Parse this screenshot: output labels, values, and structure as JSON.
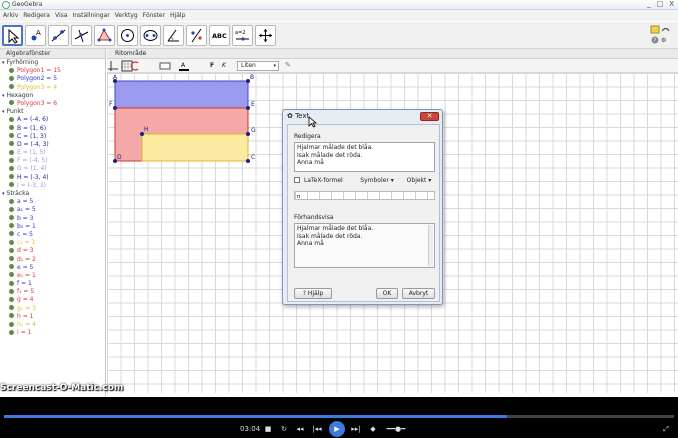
{
  "window": {
    "title": "GeoGebra",
    "controls": [
      "_",
      "□",
      "X"
    ]
  },
  "menu": [
    "Arkiv",
    "Redigera",
    "Visa",
    "Inställningar",
    "Verktyg",
    "Fönster",
    "Hjälp"
  ],
  "toolbar": {
    "tools": [
      "move-tool",
      "point-tool",
      "line-tool",
      "perpendicular-line-tool",
      "polygon-tool",
      "circle-tool",
      "ellipse-tool",
      "angle-tool",
      "reflect-tool",
      "text-tool",
      "slider-tool",
      "move-graphics-view-tool"
    ],
    "text_tool_label": "ABC",
    "slider_label": "a=2"
  },
  "algebra": {
    "title": "Algebrafönster",
    "groups": [
      {
        "name": "Fyrhörning",
        "items": [
          {
            "text": "Polygon1 = 15",
            "color": "#d8333a"
          },
          {
            "text": "Polygon2 = 5",
            "color": "#3333cc"
          },
          {
            "text": "Polygon3 = 4",
            "color": "#e0c030"
          }
        ]
      },
      {
        "name": "Hexagon",
        "items": [
          {
            "text": "Polygon3 = 6",
            "color": "#d8333a"
          }
        ]
      },
      {
        "name": "Punkt",
        "items": [
          {
            "text": "A = (-4, 6)",
            "color": "#2222aa"
          },
          {
            "text": "B = (1, 6)",
            "color": "#2222aa"
          },
          {
            "text": "C = (1, 3)",
            "color": "#2222aa"
          },
          {
            "text": "D = (-4, 3)",
            "color": "#2222aa"
          },
          {
            "text": "E = (1, 5)",
            "color": "#9999dd"
          },
          {
            "text": "F = (-4, 5)",
            "color": "#9999dd"
          },
          {
            "text": "G = (1, 4)",
            "color": "#9999dd"
          },
          {
            "text": "H = (-3, 4)",
            "color": "#2222aa"
          },
          {
            "text": "I = (-3, 3)",
            "color": "#9999dd"
          }
        ]
      },
      {
        "name": "Sträcka",
        "items": [
          {
            "text": "a = 5",
            "color": "#3333cc"
          },
          {
            "text": "a₁ = 5",
            "color": "#3333cc"
          },
          {
            "text": "b = 3",
            "color": "#3333cc"
          },
          {
            "text": "b₁ = 1",
            "color": "#3333cc"
          },
          {
            "text": "c = 5",
            "color": "#3333cc"
          },
          {
            "text": "c₁ = 1",
            "color": "#e0c030"
          },
          {
            "text": "d = 3",
            "color": "#d8333a"
          },
          {
            "text": "d₁ = 2",
            "color": "#d8333a"
          },
          {
            "text": "e = 5",
            "color": "#3333cc"
          },
          {
            "text": "e₁ = 1",
            "color": "#d8333a"
          },
          {
            "text": "f = 1",
            "color": "#3333cc"
          },
          {
            "text": "f₁ = 5",
            "color": "#d8333a"
          },
          {
            "text": "g = 4",
            "color": "#d8333a"
          },
          {
            "text": "g₁ = 3",
            "color": "#e0c030"
          },
          {
            "text": "h = 1",
            "color": "#d8333a"
          },
          {
            "text": "h₁ = 4",
            "color": "#e0c030"
          },
          {
            "text": "i = 1",
            "color": "#d8333a"
          }
        ]
      }
    ]
  },
  "graphics": {
    "title": "Ritområde",
    "font_size": "Liten",
    "style_bold": "F",
    "style_italic": "K",
    "points": [
      "A",
      "B",
      "E",
      "F",
      "G",
      "H",
      "D",
      "C"
    ]
  },
  "dialog": {
    "title": "Text",
    "edit_label": "Redigera",
    "edit_text": [
      "Hjalmar målade det blåa.",
      "Isak målade det röda.",
      "Anna må"
    ],
    "latex_label": "LaTeX-formel",
    "symbols_label": "Symboler",
    "objects_label": "Objekt",
    "preview_label": "Förhandsvisa",
    "preview_text": [
      "Hjalmar målade det blåa.",
      "Isak målade det röda.",
      "Anna må"
    ],
    "help_label": "Hjälp",
    "ok_label": "OK",
    "cancel_label": "Avbryt"
  },
  "watermark": "Screencast-O-Matic.com",
  "player": {
    "time": "03:04",
    "progress": 0.75
  }
}
